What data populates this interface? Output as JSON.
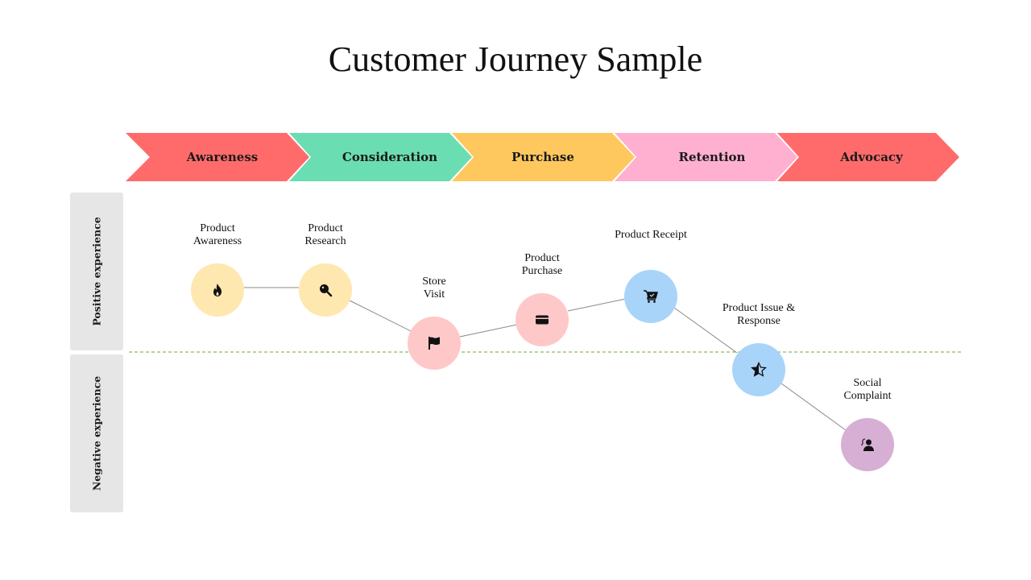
{
  "title": "Customer Journey Sample",
  "stages": [
    {
      "label": "Awareness",
      "color": "#FF6B6B"
    },
    {
      "label": "Consideration",
      "color": "#6BDDB2"
    },
    {
      "label": "Purchase",
      "color": "#FFC85F"
    },
    {
      "label": "Retention",
      "color": "#FFB0D0"
    },
    {
      "label": "Advocacy",
      "color": "#FF6B6B"
    }
  ],
  "side_labels": {
    "positive": "Positive experience",
    "negative": "Negative experience"
  },
  "divider_color": "#6AAB3C",
  "connector_color": "#888888",
  "touchpoints": [
    {
      "label_line1": "Product",
      "label_line2": "Awareness",
      "icon": "fire-icon",
      "color": "#FFE7B0",
      "sentiment": "positive"
    },
    {
      "label_line1": "Product",
      "label_line2": "Research",
      "icon": "search-icon",
      "color": "#FFE7B0",
      "sentiment": "positive"
    },
    {
      "label_line1": "Store",
      "label_line2": "Visit",
      "icon": "flag-icon",
      "color": "#FFC8C8",
      "sentiment": "neutral"
    },
    {
      "label_line1": "Product",
      "label_line2": "Purchase",
      "icon": "credit-card-icon",
      "color": "#FFC8C8",
      "sentiment": "positive"
    },
    {
      "label_line1": "Product Receipt",
      "label_line2": "",
      "icon": "cart-check-icon",
      "color": "#A8D4FA",
      "sentiment": "positive"
    },
    {
      "label_line1": "Product Issue &",
      "label_line2": "Response",
      "icon": "half-star-icon",
      "color": "#A8D4FA",
      "sentiment": "neutral"
    },
    {
      "label_line1": "Social",
      "label_line2": "Complaint",
      "icon": "user-complaint-icon",
      "color": "#D7AED4",
      "sentiment": "negative"
    }
  ]
}
